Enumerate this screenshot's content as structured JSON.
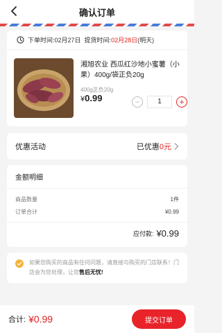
{
  "header": {
    "title": "确认订单",
    "back_icon": "chevron-left-icon"
  },
  "order": {
    "order_time_label": "下单时间: ",
    "order_time": "02月27日",
    "pickup_label": "提货时间: ",
    "pickup_date": "02月28日",
    "pickup_suffix": "(明天)",
    "product": {
      "name": "湘旭农业 西瓜红沙地小蜜薯（小果）400g/袋正负20g",
      "spec": "400g正负20g",
      "currency": "¥",
      "price": "0.99",
      "quantity": "1",
      "minus_label": "−",
      "plus_label": "+"
    }
  },
  "promo": {
    "label": "优惠活动",
    "value_prefix": "已优惠",
    "value": "0元"
  },
  "amount": {
    "title": "金额明细",
    "rows": [
      {
        "label": "商品数量",
        "value": "1件"
      },
      {
        "label": "订单合计",
        "value": "¥0.99"
      }
    ],
    "payable_label": "应付款:",
    "payable_value": "¥0.99"
  },
  "notice": {
    "text": "如果您购买的商品有任何问题，请直接与购买的门店联系！门店会为您处理，让您",
    "bold": "售后无忧!"
  },
  "footer": {
    "total_label": "合计:",
    "total_value": "¥0.99",
    "submit_label": "提交订单"
  },
  "colors": {
    "accent": "#e02020",
    "button": "#e8232a",
    "notice_icon": "#f2b23a"
  }
}
